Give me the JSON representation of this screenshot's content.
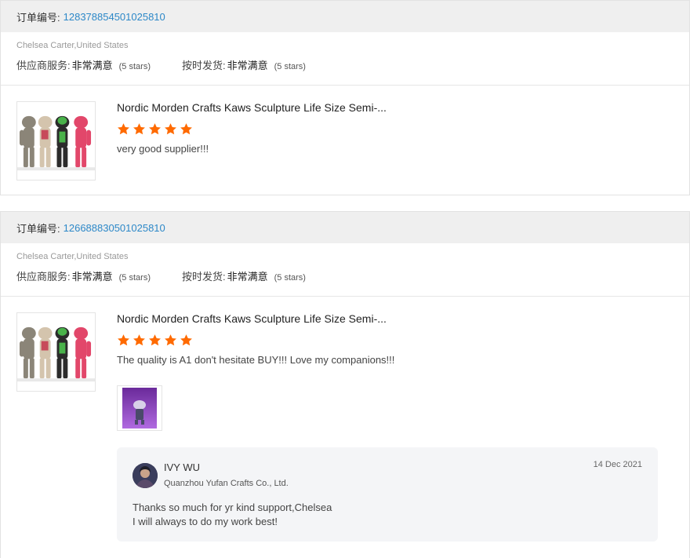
{
  "orders": [
    {
      "order_label": "订单编号:",
      "order_number": "128378854501025810",
      "buyer": "Chelsea Carter,United States",
      "ratings": [
        {
          "label": "供应商服务:",
          "value": "非常满意",
          "stars_text": "(5 stars)"
        },
        {
          "label": "按时发货:",
          "value": "非常满意",
          "stars_text": "(5 stars)"
        }
      ],
      "product_title": "Nordic Morden Crafts Kaws Sculpture Life Size Semi-...",
      "rating_stars": 5,
      "comment": "very good supplier!!!"
    },
    {
      "order_label": "订单编号:",
      "order_number": "126688830501025810",
      "buyer": "Chelsea Carter,United States",
      "ratings": [
        {
          "label": "供应商服务:",
          "value": "非常满意",
          "stars_text": "(5 stars)"
        },
        {
          "label": "按时发货:",
          "value": "非常满意",
          "stars_text": "(5 stars)"
        }
      ],
      "product_title": "Nordic Morden Crafts Kaws Sculpture Life Size Semi-...",
      "rating_stars": 5,
      "comment": "The quality is A1 don't hesitate BUY!!! Love my companions!!!",
      "reply": {
        "name": "IVY WU",
        "company": "Quanzhou Yufan Crafts Co., Ltd.",
        "date": "14 Dec 2021",
        "line1": "Thanks so much for yr kind support,Chelsea",
        "line2": "I will always to do my work best!"
      }
    }
  ],
  "colors": {
    "order_number": "#2d88c8",
    "star": "#ff6a00",
    "header_bg": "#efefef",
    "reply_bg": "#f4f5f7"
  },
  "icons": {
    "star": "star-icon",
    "avatar": "avatar",
    "product": "product-thumbnail"
  }
}
